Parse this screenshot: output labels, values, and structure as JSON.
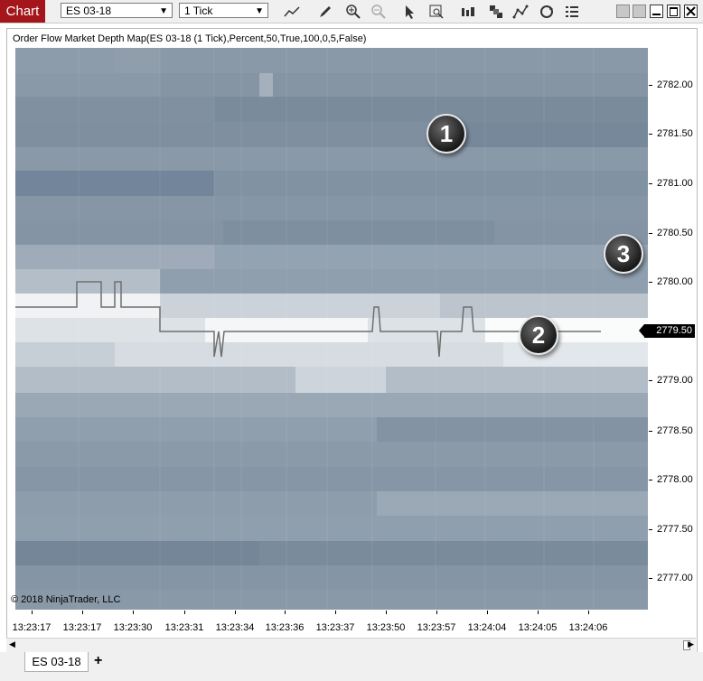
{
  "toolbar": {
    "chart_label": "Chart",
    "instrument": "ES 03-18",
    "interval": "1 Tick",
    "icons": [
      "line-tool-icon",
      "pencil-icon",
      "zoom-in-icon",
      "zoom-out-icon",
      "pointer-icon",
      "data-box-icon",
      "bar-type-icon",
      "strategy-icon",
      "drawing-tools-icon",
      "reload-icon",
      "properties-icon"
    ]
  },
  "chart": {
    "indicator_label": "Order Flow Market Depth Map(ES 03-18 (1 Tick),Percent,50,True,100,0,5,False)",
    "copyright": "© 2018 NinjaTrader, LLC",
    "y_ticks": [
      "2782.00",
      "2781.50",
      "2781.00",
      "2780.50",
      "2780.00",
      "2779.50",
      "2779.00",
      "2778.50",
      "2778.00",
      "2777.50",
      "2777.00"
    ],
    "x_ticks": [
      "13:23:17",
      "13:23:17",
      "13:23:30",
      "13:23:31",
      "13:23:34",
      "13:23:36",
      "13:23:37",
      "13:23:50",
      "13:23:57",
      "13:24:04",
      "13:24:05",
      "13:24:06"
    ],
    "last_price": "2779.50",
    "badges": [
      "1",
      "2",
      "3"
    ]
  },
  "tabs": {
    "active": "ES 03-18",
    "add": "+"
  }
}
